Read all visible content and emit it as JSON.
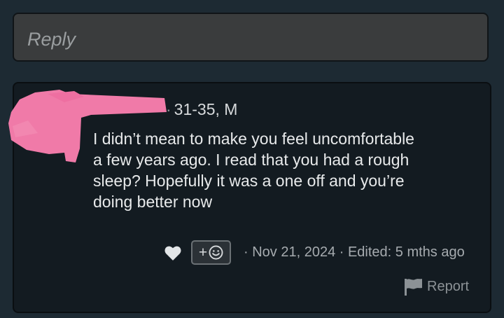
{
  "reply": {
    "placeholder": "Reply"
  },
  "comment": {
    "author_meta": "31-35, M",
    "meta_separator": "·",
    "body_lines": [
      "I didn’t mean to make you feel uncomfortable",
      "a few years ago. I read that you had a rough",
      "sleep? Hopefully it was a one off and you’re",
      "doing better now"
    ],
    "timestamp": "· Nov 21, 2024 · Edited: 5 mths ago",
    "react_label": "+",
    "report_label": "Report"
  },
  "icons": {
    "like": "heart-icon",
    "react": "smiley-icon",
    "report": "flag-icon"
  },
  "colors": {
    "background": "#1d2a33",
    "card": "#131b21",
    "reply_box": "#3a3c3d",
    "redaction": "#f07aa8",
    "text": "#e8eaeb",
    "muted": "#a6abaf"
  }
}
